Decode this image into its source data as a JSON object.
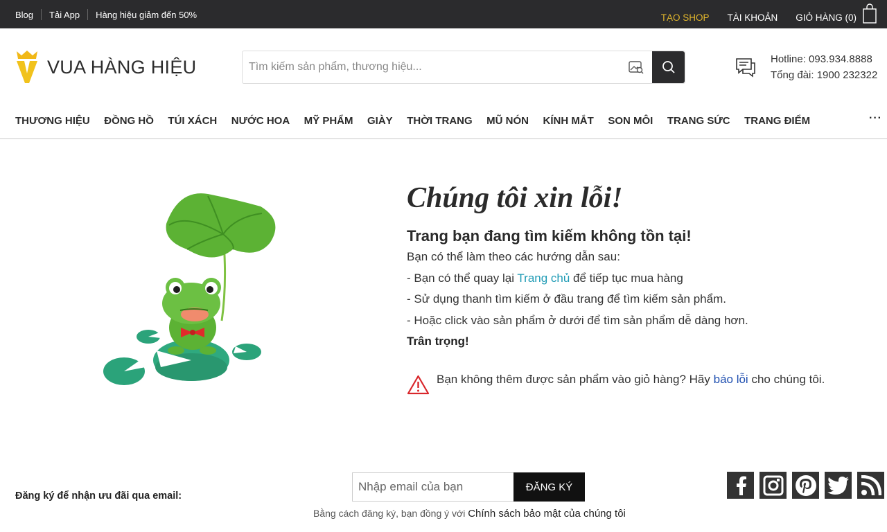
{
  "topbar": {
    "blog": "Blog",
    "app": "Tải App",
    "promo": "Hàng hiệu giảm đến 50%",
    "create_shop": "TẠO SHOP",
    "account": "TÀI KHOẢN",
    "cart": "GIỎ HÀNG (0)"
  },
  "header": {
    "logo_text": "VUA HÀNG HIỆU",
    "search_placeholder": "Tìm kiếm sản phẩm, thương hiệu...",
    "hotline": "Hotline: 093.934.8888",
    "switchboard": "Tổng đài: 1900 232322"
  },
  "nav": {
    "items": [
      "THƯƠNG HIỆU",
      "ĐỒNG HỒ",
      "TÚI XÁCH",
      "NƯỚC HOA",
      "MỸ PHẨM",
      "GIÀY",
      "THỜI TRANG",
      "MŨ NÓN",
      "KÍNH MẮT",
      "SON MÔI",
      "TRANG SỨC",
      "TRANG ĐIỂM"
    ],
    "more": "···"
  },
  "main": {
    "title": "Chúng tôi xin lỗi!",
    "subtitle": "Trang bạn đang tìm kiếm không tồn tại!",
    "intro": "Bạn có thể làm theo các hướng dẫn sau:",
    "line1_pre": "- Bạn có thể quay lại ",
    "line1_link": "Trang chủ",
    "line1_post": " để tiếp tục mua hàng",
    "line2": "- Sử dụng thanh tìm kiếm ở đầu trang để tìm kiếm sản phẩm.",
    "line3": "- Hoặc click vào sản phẩm ở dưới để tìm sản phẩm dễ dàng hơn.",
    "regards": "Trân trọng!",
    "report_pre": "Bạn không thêm được sản phẩm vào giỏ hàng? Hãy ",
    "report_link": "báo lỗi",
    "report_post": " cho chúng tôi."
  },
  "footer": {
    "subscribe_label": "Đăng ký để nhận ưu đãi qua email:",
    "email_placeholder": "Nhập email của bạn",
    "subscribe_button": "ĐĂNG KÝ",
    "policy_pre": "Bằng cách đăng ký, bạn đồng ý với ",
    "policy_link": "Chính sách bảo mật của chúng tôi",
    "social": [
      "facebook-icon",
      "instagram-icon",
      "pinterest-icon",
      "twitter-icon",
      "rss-icon"
    ]
  },
  "colors": {
    "topbar_bg": "#2b2b2d",
    "accent_gold": "#e0b52d",
    "link_teal": "#1f9bb5",
    "link_blue": "#1f4fb0",
    "warning_red": "#d9262b"
  }
}
